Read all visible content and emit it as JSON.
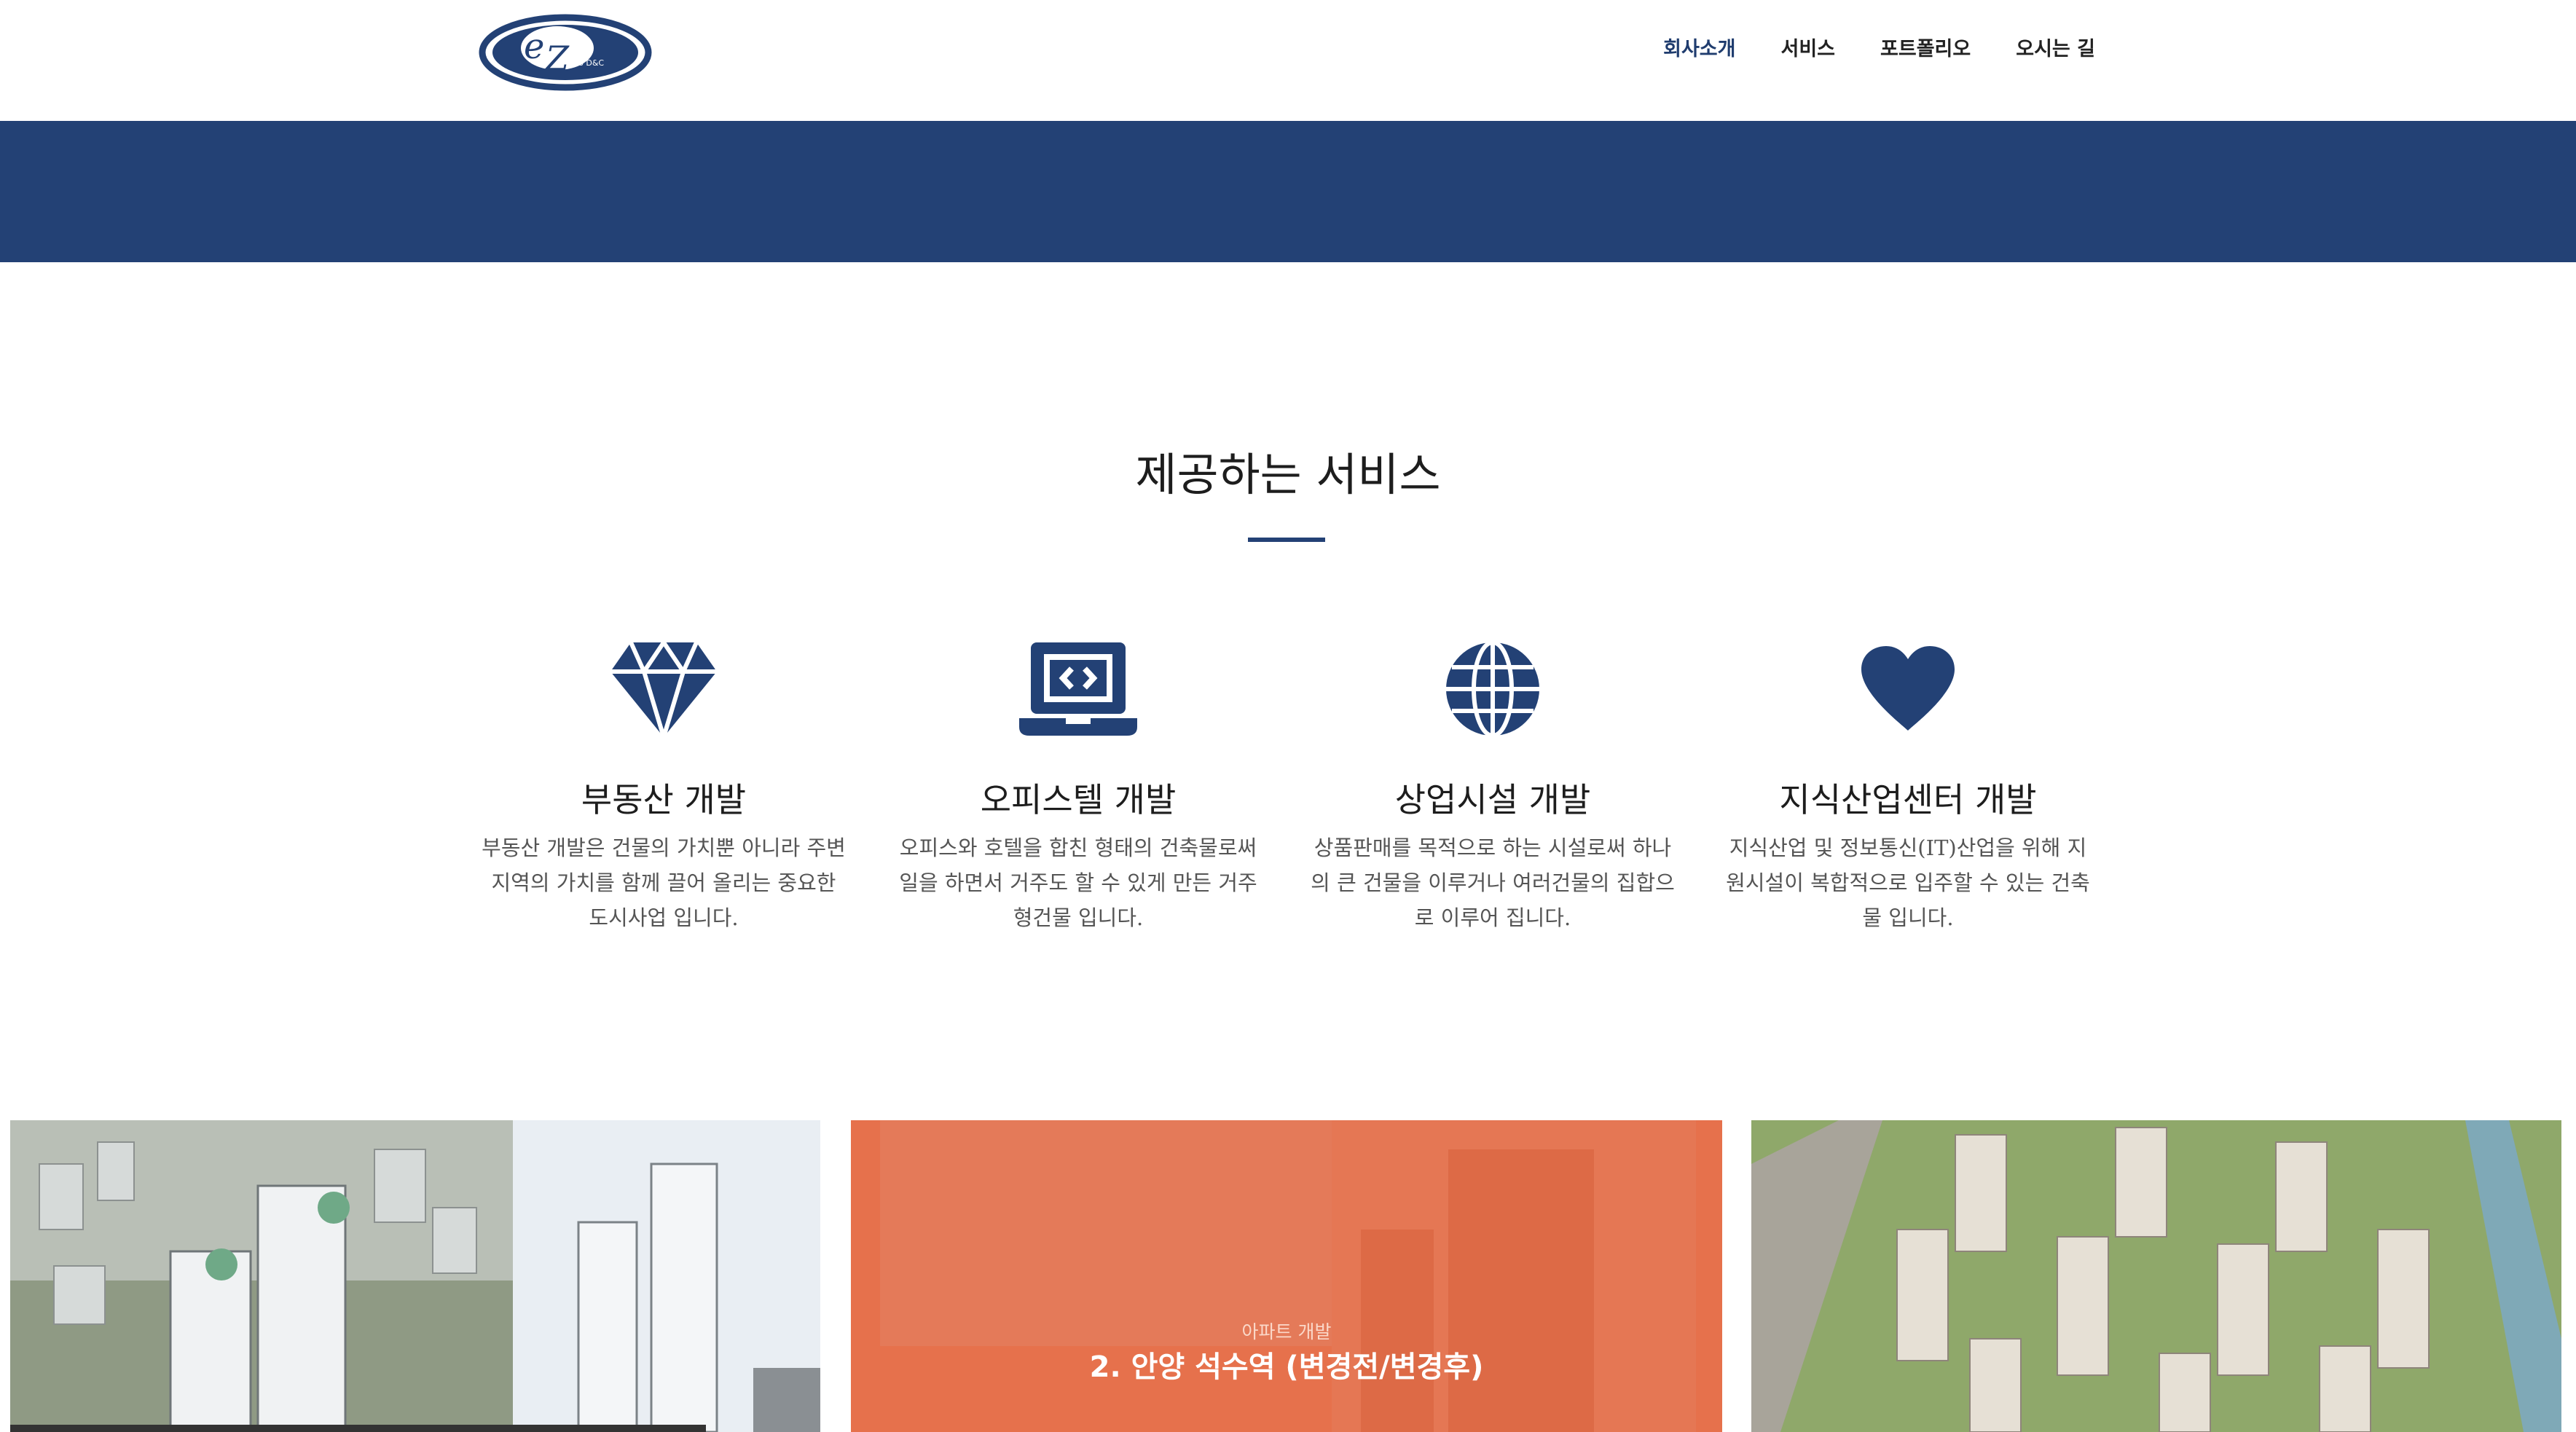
{
  "header": {
    "logo_text": "ez Ro D&C",
    "nav": [
      {
        "label": "회사소개",
        "active": true
      },
      {
        "label": "서비스",
        "active": false
      },
      {
        "label": "포트폴리오",
        "active": false
      },
      {
        "label": "오시는 길",
        "active": false
      }
    ]
  },
  "colors": {
    "brand_navy": "#234175",
    "accent_orange": "#e6714c"
  },
  "services": {
    "title": "제공하는 서비스",
    "items": [
      {
        "icon": "diamond-icon",
        "title": "부동산 개발",
        "desc_lines": [
          "부동산 개발은 건물의 가치뿐 아니라 주변",
          "지역의 가치를 함께 끌어 올리는 중요한",
          "도시사업 입니다."
        ]
      },
      {
        "icon": "laptop-code-icon",
        "title": "오피스텔 개발",
        "desc_lines": [
          "오피스와 호텔을 합친 형태의 건축물로써",
          "일을 하면서 거주도 할 수 있게 만든 거주",
          "형건물 입니다."
        ]
      },
      {
        "icon": "globe-icon",
        "title": "상업시설 개발",
        "desc_lines": [
          "상품판매를 목적으로 하는 시설로써 하나",
          "의 큰 건물을 이루거나 여러건물의 집합으",
          "로 이루어 집니다."
        ]
      },
      {
        "icon": "heart-icon",
        "title": "지식산업센터 개발",
        "desc_lines": [
          "지식산업 및 정보통신(IT)산업을 위해 지",
          "원시설이 복합적으로 입주할 수 있는 건축",
          "물 입니다."
        ]
      }
    ]
  },
  "portfolio": {
    "featured": {
      "category": "아파트 개발",
      "title": "2. 안양 석수역 (변경전/변경후)"
    }
  }
}
